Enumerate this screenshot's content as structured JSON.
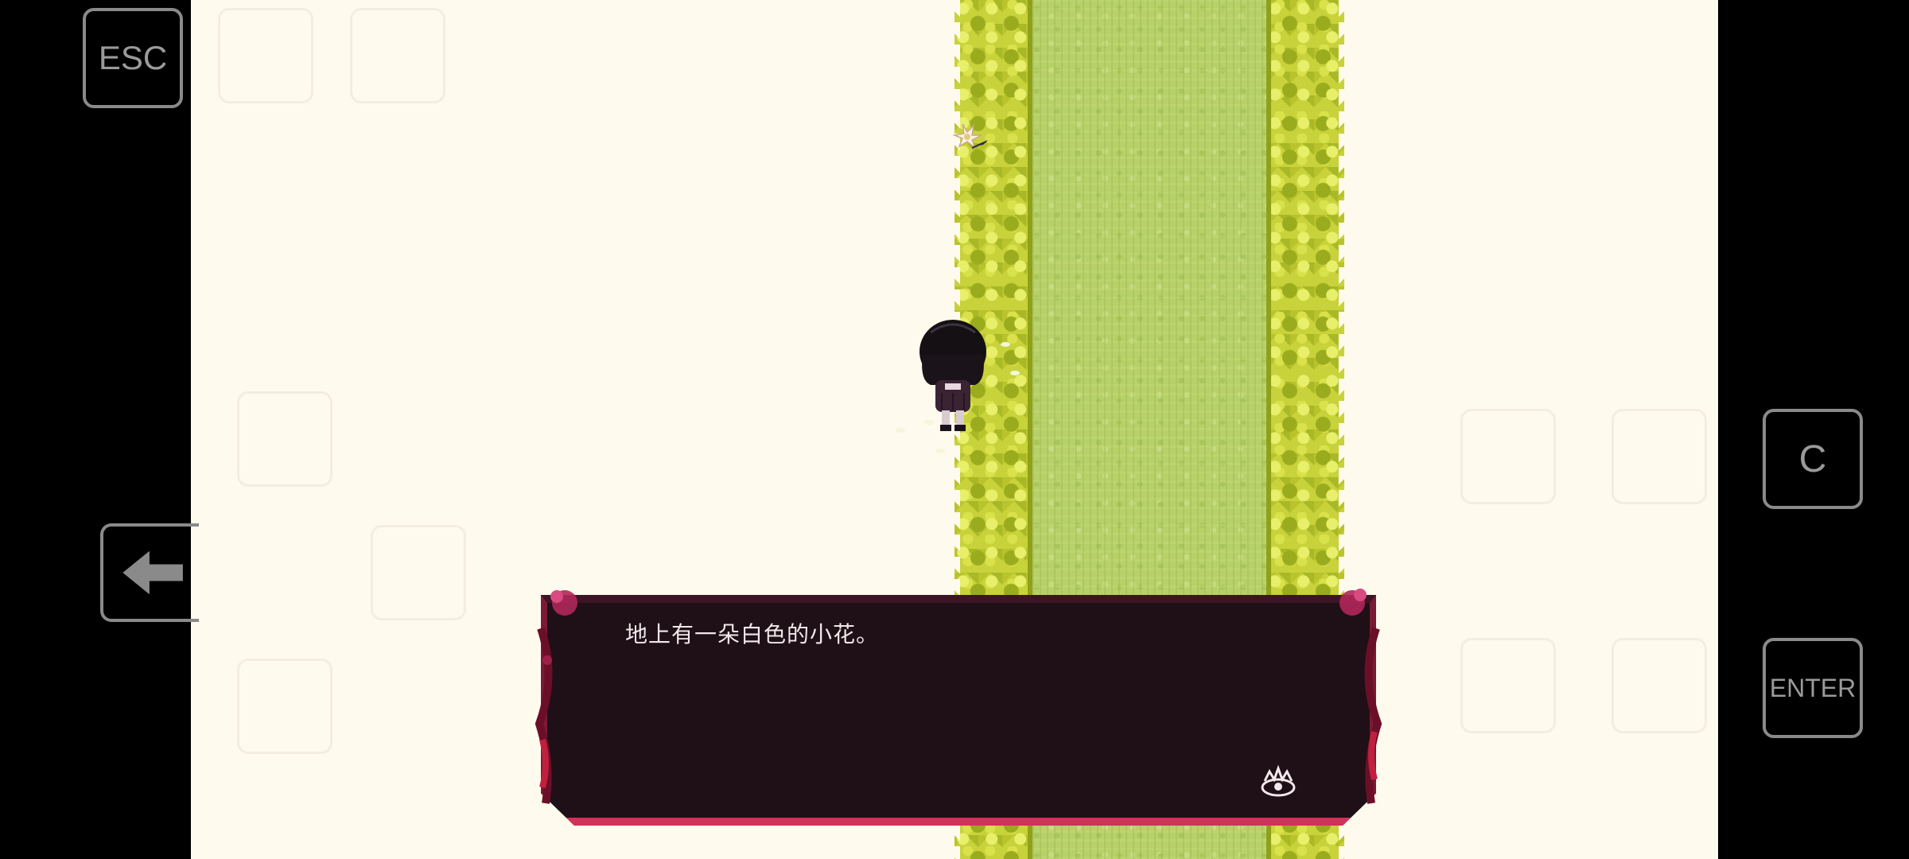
{
  "controls": {
    "esc_label": "ESC",
    "c_label": "C",
    "enter_label": "ENTER"
  },
  "dialogue": {
    "text": "地上有一朵白色的小花。"
  },
  "colors": {
    "background_letterbox": "#000000",
    "game_background": "#fffaee",
    "grass": "#b7d16a",
    "hedge": "#c8d23a",
    "dialogue_bg": "#1f0f16",
    "dialogue_accent": "#d0325a",
    "button_border": "#8a8a8a"
  },
  "icons": {
    "left_arrow": "arrow-left-icon",
    "advance": "crown-advance-icon"
  }
}
